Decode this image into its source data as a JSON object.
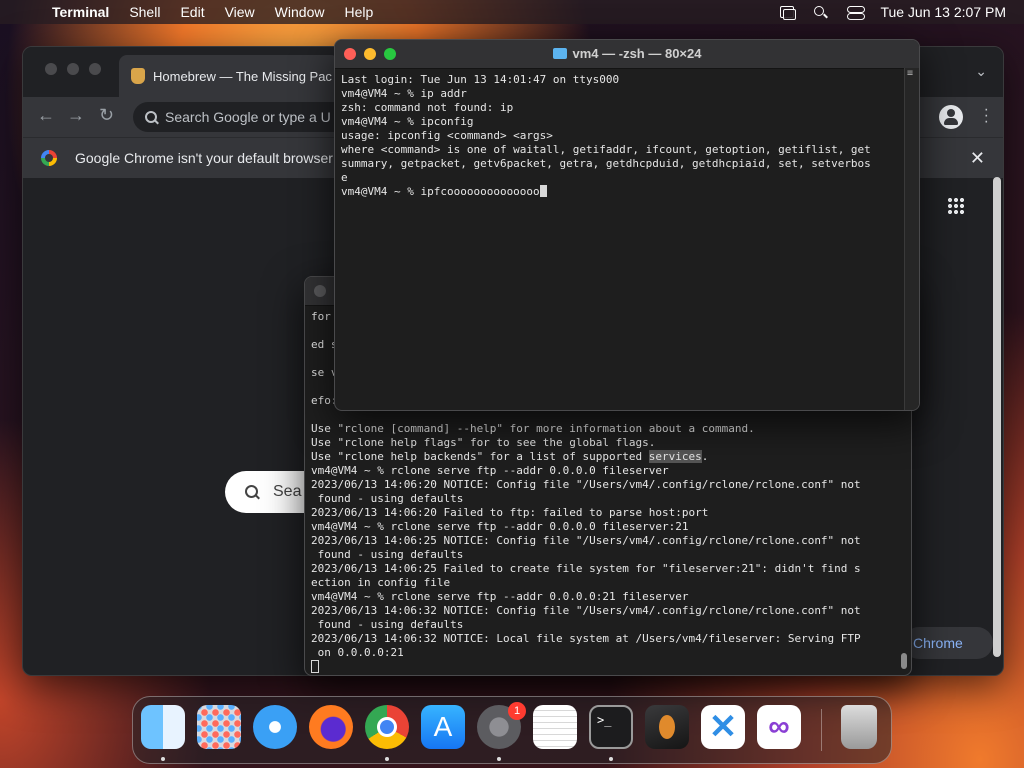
{
  "menubar": {
    "app_name": "Terminal",
    "items": [
      "Shell",
      "Edit",
      "View",
      "Window",
      "Help"
    ],
    "clock": "Tue Jun 13  2:07 PM"
  },
  "chrome": {
    "tab_title": "Homebrew — The Missing Pac",
    "omnibox_placeholder": "Search Google or type a U",
    "infobar_text": "Google Chrome isn't your default browser",
    "search_box_text": "Sea",
    "pill_text": "Chrome"
  },
  "terminal_front": {
    "title": "vm4 — -zsh — 80×24",
    "lines": [
      "Last login: Tue Jun 13 14:01:47 on ttys000",
      "vm4@VM4 ~ % ip addr",
      "zsh: command not found: ip",
      "vm4@VM4 ~ % ipconfig",
      "usage: ipconfig <command> <args>",
      "where <command> is one of waitall, getifaddr, ifcount, getoption, getiflist, get",
      "summary, getpacket, getv6packet, getra, getdhcpduid, getdhcpiaid, set, setverbos",
      "e"
    ],
    "prompt_line": "vm4@VM4 ~ % ipfcoooooooooooooo"
  },
  "terminal_back": {
    "partial_lines": [
      "for",
      "",
      "ed s",
      "",
      "se v",
      "",
      "efo:",
      ""
    ],
    "line_a": "Use \"rclone [command] --help\" for more information about a command.",
    "line_b": "Use \"rclone help flags\" for to see the global flags.",
    "line_c_pre": "Use \"rclone help backends\" for a list of supported ",
    "line_c_hl": "services",
    "line_c_post": ".",
    "log_lines": [
      "vm4@VM4 ~ % rclone serve ftp --addr 0.0.0.0 fileserver",
      "2023/06/13 14:06:20 NOTICE: Config file \"/Users/vm4/.config/rclone/rclone.conf\" not",
      " found - using defaults",
      "2023/06/13 14:06:20 Failed to ftp: failed to parse host:port",
      "vm4@VM4 ~ % rclone serve ftp --addr 0.0.0.0 fileserver:21",
      "2023/06/13 14:06:25 NOTICE: Config file \"/Users/vm4/.config/rclone/rclone.conf\" not",
      " found - using defaults",
      "2023/06/13 14:06:25 Failed to create file system for \"fileserver:21\": didn't find s",
      "ection in config file",
      "vm4@VM4 ~ % rclone serve ftp --addr 0.0.0.0:21 fileserver",
      "2023/06/13 14:06:32 NOTICE: Config file \"/Users/vm4/.config/rclone/rclone.conf\" not",
      " found - using defaults",
      "2023/06/13 14:06:32 NOTICE: Local file system at /Users/vm4/fileserver: Serving FTP",
      " on 0.0.0.0:21"
    ]
  },
  "dock": {
    "settings_badge": "1",
    "apps": [
      "finder-icon",
      "launchpad-icon",
      "safari-icon",
      "firefox-icon",
      "chrome-icon",
      "app-store-icon",
      "system-settings-icon",
      "textedit-icon",
      "terminal-icon",
      "garageband-icon",
      "vscode-icon",
      "visual-studio-icon",
      "trash-icon"
    ]
  },
  "colors": {
    "traffic_red": "#ff5f57",
    "traffic_yellow": "#febc2e",
    "traffic_green": "#28c840"
  }
}
